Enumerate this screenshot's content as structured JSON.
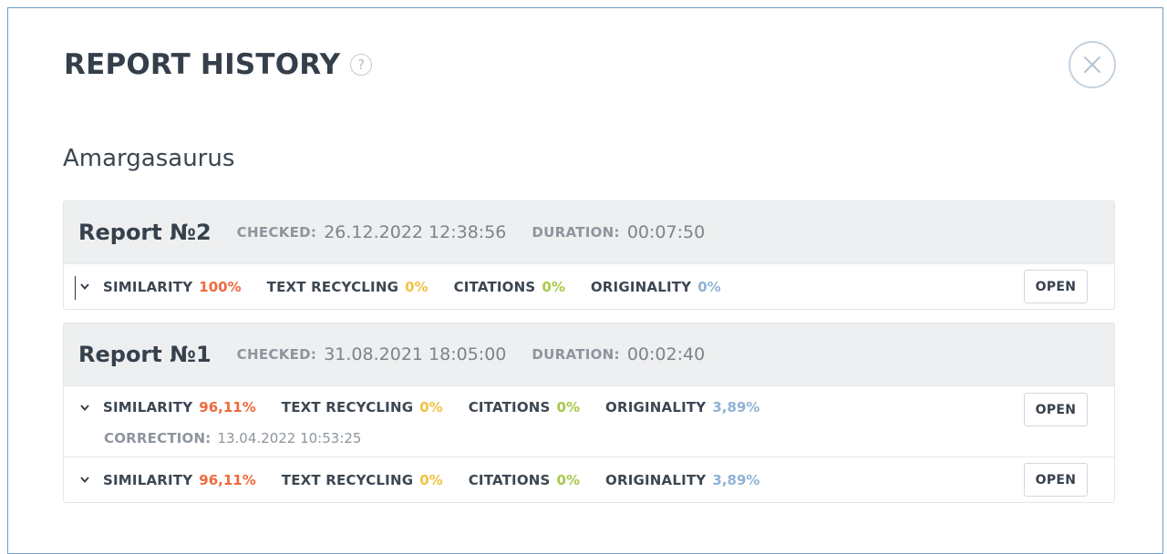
{
  "modal": {
    "title": "REPORT HISTORY",
    "help_icon": "question-circle-icon",
    "close_icon": "close-icon"
  },
  "document": {
    "name": "Amargasaurus"
  },
  "reports": [
    {
      "name": "Report №2",
      "checked_label": "CHECKED:",
      "checked_value": "26.12.2022 12:38:56",
      "duration_label": "DURATION:",
      "duration_value": "00:07:50",
      "checks": [
        {
          "similarity_label": "SIMILARITY",
          "similarity_value": "100%",
          "recycling_label": "TEXT RECYCLING",
          "recycling_value": "0%",
          "citations_label": "CITATIONS",
          "citations_value": "0%",
          "originality_label": "ORIGINALITY",
          "originality_value": "0%",
          "open_label": "OPEN"
        }
      ]
    },
    {
      "name": "Report №1",
      "checked_label": "CHECKED:",
      "checked_value": "31.08.2021 18:05:00",
      "duration_label": "DURATION:",
      "duration_value": "00:02:40",
      "checks": [
        {
          "similarity_label": "SIMILARITY",
          "similarity_value": "96,11%",
          "recycling_label": "TEXT RECYCLING",
          "recycling_value": "0%",
          "citations_label": "CITATIONS",
          "citations_value": "0%",
          "originality_label": "ORIGINALITY",
          "originality_value": "3,89%",
          "correction_label": "CORRECTION:",
          "correction_value": "13.04.2022 10:53:25",
          "open_label": "OPEN"
        },
        {
          "similarity_label": "SIMILARITY",
          "similarity_value": "96,11%",
          "recycling_label": "TEXT RECYCLING",
          "recycling_value": "0%",
          "citations_label": "CITATIONS",
          "citations_value": "0%",
          "originality_label": "ORIGINALITY",
          "originality_value": "3,89%",
          "open_label": "OPEN"
        }
      ]
    }
  ],
  "colors": {
    "similarity": "#ee6a3d",
    "text_recycling": "#f2c144",
    "citations": "#a8c94a",
    "originality": "#8fb3d6",
    "modal_border": "#6d9ec9"
  }
}
